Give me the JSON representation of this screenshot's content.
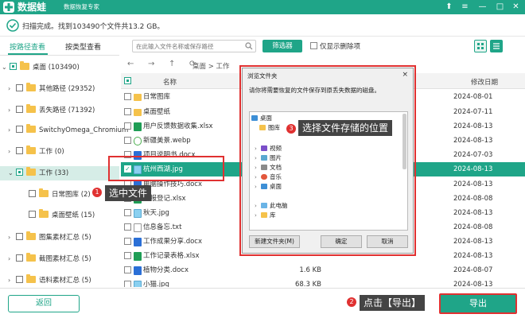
{
  "app": {
    "name": "数据蛙",
    "subtitle": "数据恢复专家",
    "brand_color": "#1fa588"
  },
  "status": {
    "text": "扫描完成。找到103490个文件共13.2 GB。"
  },
  "tabs": [
    {
      "label": "按路径查看",
      "active": true
    },
    {
      "label": "按类型查看",
      "active": false
    }
  ],
  "toolbar": {
    "search_placeholder": "在此输入文件名称或保存路径",
    "filter_label": "筛选器",
    "deleted_only_label": "仅显示删除项"
  },
  "tree": [
    {
      "label": "桌面 (103490)"
    },
    {
      "label": "其他路径 (29352)"
    },
    {
      "label": "丢失路径 (71392)"
    },
    {
      "label": "SwitchyOmega_Chromium"
    },
    {
      "label": "工作 (0)"
    },
    {
      "label": "工作 (33)"
    },
    {
      "label": "日常图库 (2)"
    },
    {
      "label": "桌面壁纸 (15)"
    },
    {
      "label": "图集素材汇总 (5)"
    },
    {
      "label": "截图素材汇总 (5)"
    },
    {
      "label": "语料素材汇总 (5)"
    }
  ],
  "navbar": {
    "back": "←",
    "forward": "→",
    "up": "↑",
    "refresh": "⟳",
    "path": "桌面 > 工作"
  },
  "columns": {
    "name": "名称",
    "date": "修改日期"
  },
  "files": [
    {
      "name": "日常图库",
      "size": "",
      "date": "2024-08-01"
    },
    {
      "name": "桌面壁纸",
      "size": "",
      "date": "2024-07-11"
    },
    {
      "name": "用户反馈数据收集.xlsx",
      "size": "",
      "date": "2024-08-13"
    },
    {
      "name": "新疆美景.webp",
      "size": "",
      "date": "2024-08-13"
    },
    {
      "name": "项目说明书.docx",
      "size": "",
      "date": "2024-07-03"
    },
    {
      "name": "杭州西湖.jpg",
      "size": "",
      "date": "2024-08-13"
    },
    {
      "name": "电脑操作技巧.docx",
      "size": "",
      "date": "2024-08-13"
    },
    {
      "name": "日报登记.xlsx",
      "size": "",
      "date": "2024-08-08"
    },
    {
      "name": "秋天.jpg",
      "size": "",
      "date": "2024-08-13"
    },
    {
      "name": "信息备忘.txt",
      "size": "",
      "date": "2024-08-08"
    },
    {
      "name": "工作成果分享.docx",
      "size": "",
      "date": "2024-08-13"
    },
    {
      "name": "工作记录表格.xlsx",
      "size": "",
      "date": "2024-08-13"
    },
    {
      "name": "植物分类.docx",
      "size": "1.6 KB",
      "date": "2024-08-07"
    },
    {
      "name": "小猫.jpg",
      "size": "68.3 KB",
      "date": "2024-08-13"
    }
  ],
  "footer": {
    "back_label": "返回",
    "export_label": "导出"
  },
  "annotations": {
    "step1": {
      "num": "1",
      "text": "选中文件"
    },
    "step2": {
      "num": "2",
      "text": "点击【导出】"
    },
    "step3": {
      "num": "3",
      "text": "选择文件存储的位置"
    }
  },
  "dialog": {
    "title": "浏览文件夹",
    "close": "×",
    "message": "请你将需要恢复的文件保存到原丢失数据的磁盘。",
    "tree": [
      "桌面",
      "图库",
      "视频",
      "图片",
      "文档",
      "音乐",
      "桌面",
      "此电脑",
      "库"
    ],
    "new_folder": "新建文件夹(M)",
    "ok": "确定",
    "cancel": "取消"
  }
}
